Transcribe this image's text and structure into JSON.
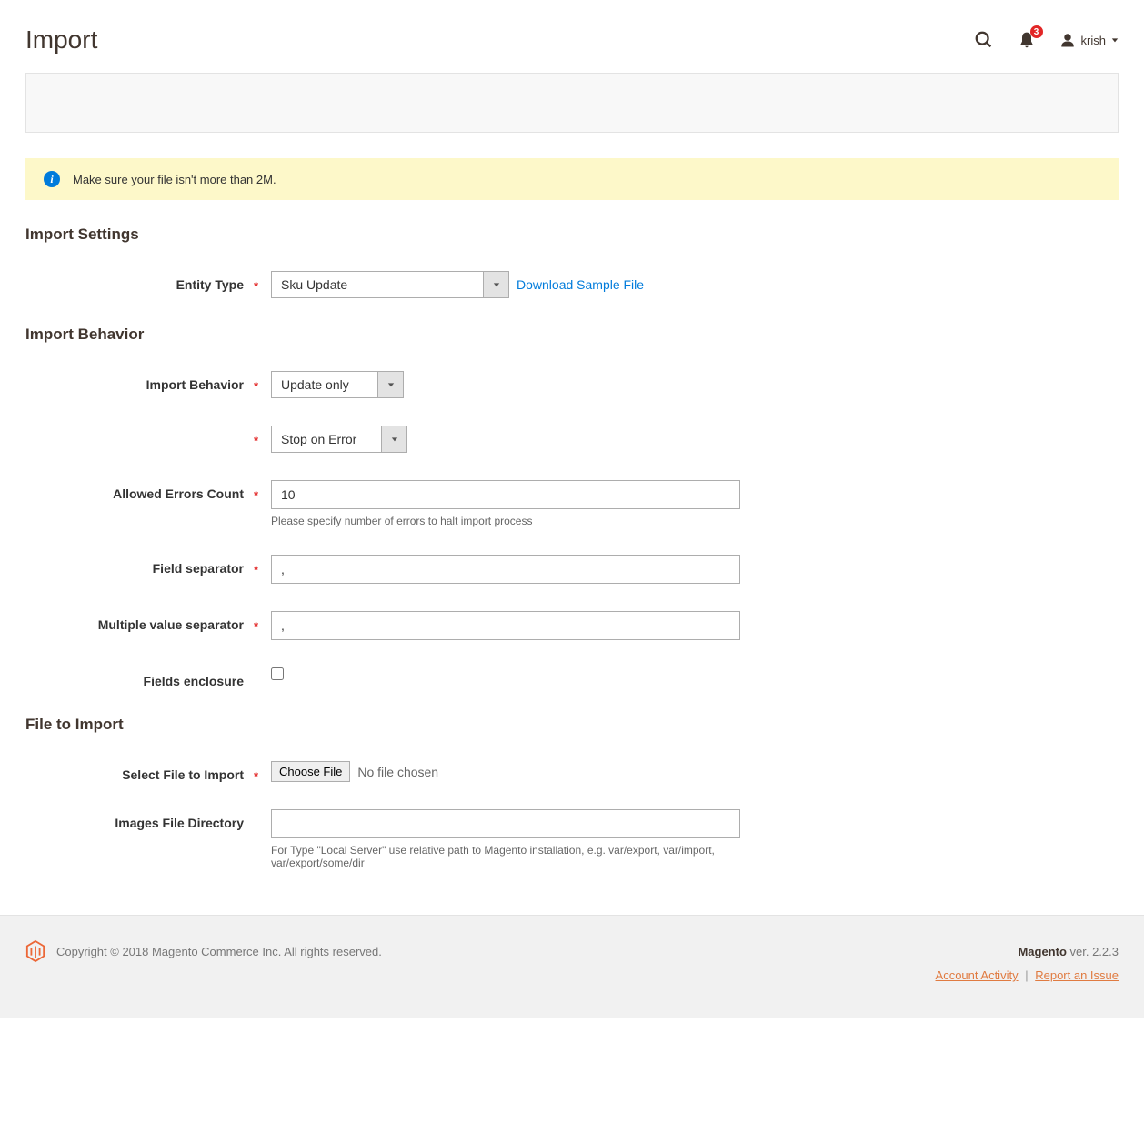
{
  "header": {
    "page_title": "Import",
    "notification_count": "3",
    "username": "krish"
  },
  "info_banner": {
    "text": "Make sure your file isn't more than 2M."
  },
  "sections": {
    "import_settings": {
      "title": "Import Settings",
      "entity_type": {
        "label": "Entity Type",
        "value": "Sku Update",
        "sample_link": "Download Sample File"
      }
    },
    "import_behavior": {
      "title": "Import Behavior",
      "behavior": {
        "label": "Import Behavior",
        "value": "Update only"
      },
      "validation": {
        "value": "Stop on Error"
      },
      "allowed_errors": {
        "label": "Allowed Errors Count",
        "value": "10",
        "hint": "Please specify number of errors to halt import process"
      },
      "field_separator": {
        "label": "Field separator",
        "value": ","
      },
      "multi_separator": {
        "label": "Multiple value separator",
        "value": ","
      },
      "fields_enclosure": {
        "label": "Fields enclosure"
      }
    },
    "file_import": {
      "title": "File to Import",
      "select_file": {
        "label": "Select File to Import",
        "button": "Choose File",
        "status": "No file chosen"
      },
      "images_dir": {
        "label": "Images File Directory",
        "value": "",
        "hint": "For Type \"Local Server\" use relative path to Magento installation, e.g. var/export, var/import, var/export/some/dir"
      }
    }
  },
  "footer": {
    "copyright": "Copyright © 2018 Magento Commerce Inc. All rights reserved.",
    "brand": "Magento",
    "version": "ver. 2.2.3",
    "account_activity": "Account Activity",
    "report_issue": "Report an Issue"
  }
}
